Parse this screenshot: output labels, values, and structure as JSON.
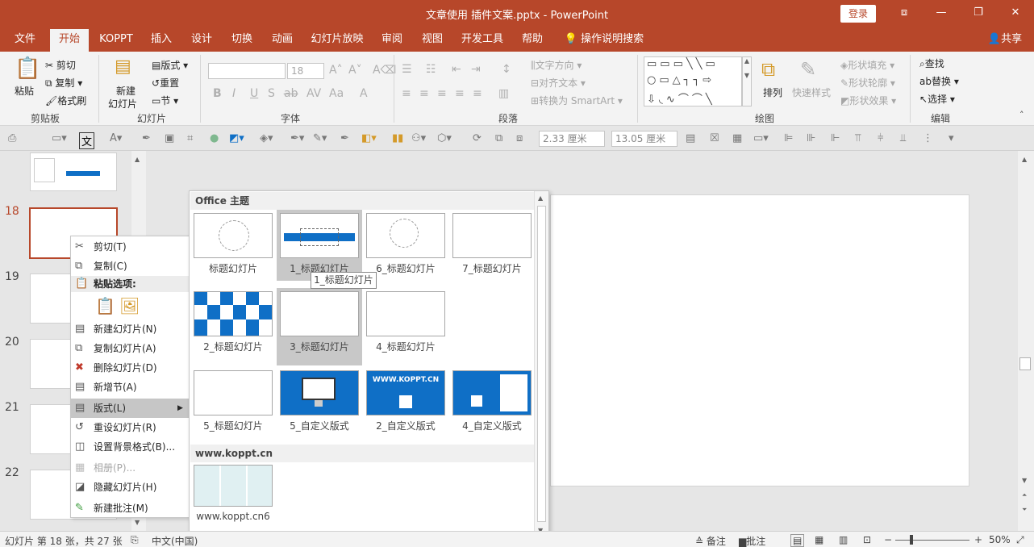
{
  "window": {
    "title": "文章使用 插件文案.pptx  -  PowerPoint",
    "login": "登录",
    "share": "共享"
  },
  "tabs": [
    "文件",
    "开始",
    "KOPPT",
    "插入",
    "设计",
    "切换",
    "动画",
    "幻灯片放映",
    "审阅",
    "视图",
    "开发工具",
    "帮助"
  ],
  "tell_me": "操作说明搜索",
  "ribbon": {
    "clipboard": {
      "paste": "粘贴",
      "cut": "剪切",
      "copy": "复制",
      "format_painter": "格式刷",
      "label": "剪贴板"
    },
    "slides": {
      "new_slide_1": "新建",
      "new_slide_2": "幻灯片",
      "layout": "版式",
      "reset": "重置",
      "section": "节",
      "label": "幻灯片"
    },
    "font": {
      "font_size": "18",
      "label": "字体"
    },
    "paragraph": {
      "text_direction": "文字方向",
      "align_text": "对齐文本",
      "convert_smartart": "转换为 SmartArt",
      "label": "段落"
    },
    "drawing": {
      "arrange": "排列",
      "quick_styles": "快速样式",
      "shape_fill": "形状填充",
      "shape_outline": "形状轮廓",
      "shape_effects": "形状效果",
      "label": "绘图"
    },
    "editing": {
      "find": "查找",
      "replace": "替换",
      "select": "选择",
      "label": "编辑"
    }
  },
  "quick_toolbar": {
    "width": "2.33 厘米",
    "height": "13.05 厘米"
  },
  "slide_numbers": [
    "18",
    "19",
    "20",
    "21",
    "22"
  ],
  "context_menu": {
    "items": [
      {
        "label": "剪切(T)",
        "icon": "✂"
      },
      {
        "label": "复制(C)",
        "icon": "⧉"
      },
      {
        "label": "粘贴选项:",
        "icon": "📋"
      },
      {
        "label": "新建幻灯片(N)",
        "icon": "▤"
      },
      {
        "label": "复制幻灯片(A)",
        "icon": "⧉"
      },
      {
        "label": "删除幻灯片(D)",
        "icon": "✖"
      },
      {
        "label": "新增节(A)",
        "icon": "▤"
      },
      {
        "label": "版式(L)",
        "icon": "▤"
      },
      {
        "label": "重设幻灯片(R)",
        "icon": "↺"
      },
      {
        "label": "设置背景格式(B)...",
        "icon": "◫"
      },
      {
        "label": "相册(P)...",
        "icon": "▦"
      },
      {
        "label": "隐藏幻灯片(H)",
        "icon": "◪"
      },
      {
        "label": "新建批注(M)",
        "icon": "✎"
      }
    ]
  },
  "gallery": {
    "section1": "Office 主题",
    "section2": "www.koppt.cn",
    "tooltip": "1_标题幻灯片",
    "layouts": [
      "标题幻灯片",
      "1_标题幻灯片",
      "6_标题幻灯片",
      "7_标题幻灯片",
      "2_标题幻灯片",
      "3_标题幻灯片",
      "4_标题幻灯片",
      "5_标题幻灯片",
      "5_自定义版式",
      "2_自定义版式",
      "4_自定义版式",
      "www.koppt.cn6"
    ],
    "preview_text": "WWW.KOPPT.CN"
  },
  "status": {
    "slide_info": "幻灯片 第 18 张，共 27 张",
    "language": "中文(中国)",
    "notes": "备注",
    "comments": "批注",
    "zoom": "50%"
  },
  "colors": {
    "accent": "#b7472a",
    "blue": "#0f6fc6"
  }
}
